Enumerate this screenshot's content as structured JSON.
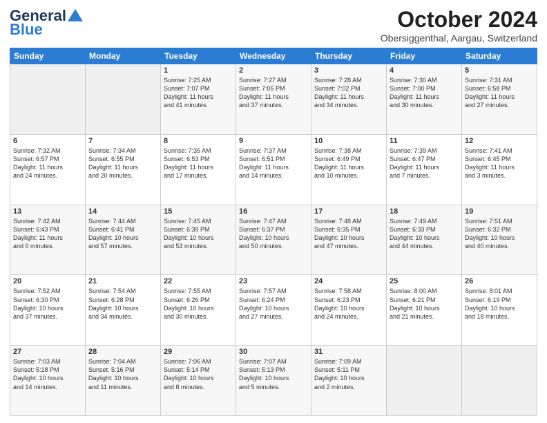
{
  "header": {
    "logo_line1": "General",
    "logo_line2": "Blue",
    "title": "October 2024",
    "subtitle": "Obersiggenthal, Aargau, Switzerland"
  },
  "days_of_week": [
    "Sunday",
    "Monday",
    "Tuesday",
    "Wednesday",
    "Thursday",
    "Friday",
    "Saturday"
  ],
  "weeks": [
    [
      {
        "day": "",
        "info": ""
      },
      {
        "day": "",
        "info": ""
      },
      {
        "day": "1",
        "info": "Sunrise: 7:25 AM\nSunset: 7:07 PM\nDaylight: 11 hours\nand 41 minutes."
      },
      {
        "day": "2",
        "info": "Sunrise: 7:27 AM\nSunset: 7:05 PM\nDaylight: 11 hours\nand 37 minutes."
      },
      {
        "day": "3",
        "info": "Sunrise: 7:28 AM\nSunset: 7:02 PM\nDaylight: 11 hours\nand 34 minutes."
      },
      {
        "day": "4",
        "info": "Sunrise: 7:30 AM\nSunset: 7:00 PM\nDaylight: 11 hours\nand 30 minutes."
      },
      {
        "day": "5",
        "info": "Sunrise: 7:31 AM\nSunset: 6:58 PM\nDaylight: 11 hours\nand 27 minutes."
      }
    ],
    [
      {
        "day": "6",
        "info": "Sunrise: 7:32 AM\nSunset: 6:57 PM\nDaylight: 11 hours\nand 24 minutes."
      },
      {
        "day": "7",
        "info": "Sunrise: 7:34 AM\nSunset: 6:55 PM\nDaylight: 11 hours\nand 20 minutes."
      },
      {
        "day": "8",
        "info": "Sunrise: 7:35 AM\nSunset: 6:53 PM\nDaylight: 11 hours\nand 17 minutes."
      },
      {
        "day": "9",
        "info": "Sunrise: 7:37 AM\nSunset: 6:51 PM\nDaylight: 11 hours\nand 14 minutes."
      },
      {
        "day": "10",
        "info": "Sunrise: 7:38 AM\nSunset: 6:49 PM\nDaylight: 11 hours\nand 10 minutes."
      },
      {
        "day": "11",
        "info": "Sunrise: 7:39 AM\nSunset: 6:47 PM\nDaylight: 11 hours\nand 7 minutes."
      },
      {
        "day": "12",
        "info": "Sunrise: 7:41 AM\nSunset: 6:45 PM\nDaylight: 11 hours\nand 3 minutes."
      }
    ],
    [
      {
        "day": "13",
        "info": "Sunrise: 7:42 AM\nSunset: 6:43 PM\nDaylight: 11 hours\nand 0 minutes."
      },
      {
        "day": "14",
        "info": "Sunrise: 7:44 AM\nSunset: 6:41 PM\nDaylight: 10 hours\nand 57 minutes."
      },
      {
        "day": "15",
        "info": "Sunrise: 7:45 AM\nSunset: 6:39 PM\nDaylight: 10 hours\nand 53 minutes."
      },
      {
        "day": "16",
        "info": "Sunrise: 7:47 AM\nSunset: 6:37 PM\nDaylight: 10 hours\nand 50 minutes."
      },
      {
        "day": "17",
        "info": "Sunrise: 7:48 AM\nSunset: 6:35 PM\nDaylight: 10 hours\nand 47 minutes."
      },
      {
        "day": "18",
        "info": "Sunrise: 7:49 AM\nSunset: 6:33 PM\nDaylight: 10 hours\nand 44 minutes."
      },
      {
        "day": "19",
        "info": "Sunrise: 7:51 AM\nSunset: 6:32 PM\nDaylight: 10 hours\nand 40 minutes."
      }
    ],
    [
      {
        "day": "20",
        "info": "Sunrise: 7:52 AM\nSunset: 6:30 PM\nDaylight: 10 hours\nand 37 minutes."
      },
      {
        "day": "21",
        "info": "Sunrise: 7:54 AM\nSunset: 6:28 PM\nDaylight: 10 hours\nand 34 minutes."
      },
      {
        "day": "22",
        "info": "Sunrise: 7:55 AM\nSunset: 6:26 PM\nDaylight: 10 hours\nand 30 minutes."
      },
      {
        "day": "23",
        "info": "Sunrise: 7:57 AM\nSunset: 6:24 PM\nDaylight: 10 hours\nand 27 minutes."
      },
      {
        "day": "24",
        "info": "Sunrise: 7:58 AM\nSunset: 6:23 PM\nDaylight: 10 hours\nand 24 minutes."
      },
      {
        "day": "25",
        "info": "Sunrise: 8:00 AM\nSunset: 6:21 PM\nDaylight: 10 hours\nand 21 minutes."
      },
      {
        "day": "26",
        "info": "Sunrise: 8:01 AM\nSunset: 6:19 PM\nDaylight: 10 hours\nand 18 minutes."
      }
    ],
    [
      {
        "day": "27",
        "info": "Sunrise: 7:03 AM\nSunset: 5:18 PM\nDaylight: 10 hours\nand 14 minutes."
      },
      {
        "day": "28",
        "info": "Sunrise: 7:04 AM\nSunset: 5:16 PM\nDaylight: 10 hours\nand 11 minutes."
      },
      {
        "day": "29",
        "info": "Sunrise: 7:06 AM\nSunset: 5:14 PM\nDaylight: 10 hours\nand 8 minutes."
      },
      {
        "day": "30",
        "info": "Sunrise: 7:07 AM\nSunset: 5:13 PM\nDaylight: 10 hours\nand 5 minutes."
      },
      {
        "day": "31",
        "info": "Sunrise: 7:09 AM\nSunset: 5:11 PM\nDaylight: 10 hours\nand 2 minutes."
      },
      {
        "day": "",
        "info": ""
      },
      {
        "day": "",
        "info": ""
      }
    ]
  ]
}
